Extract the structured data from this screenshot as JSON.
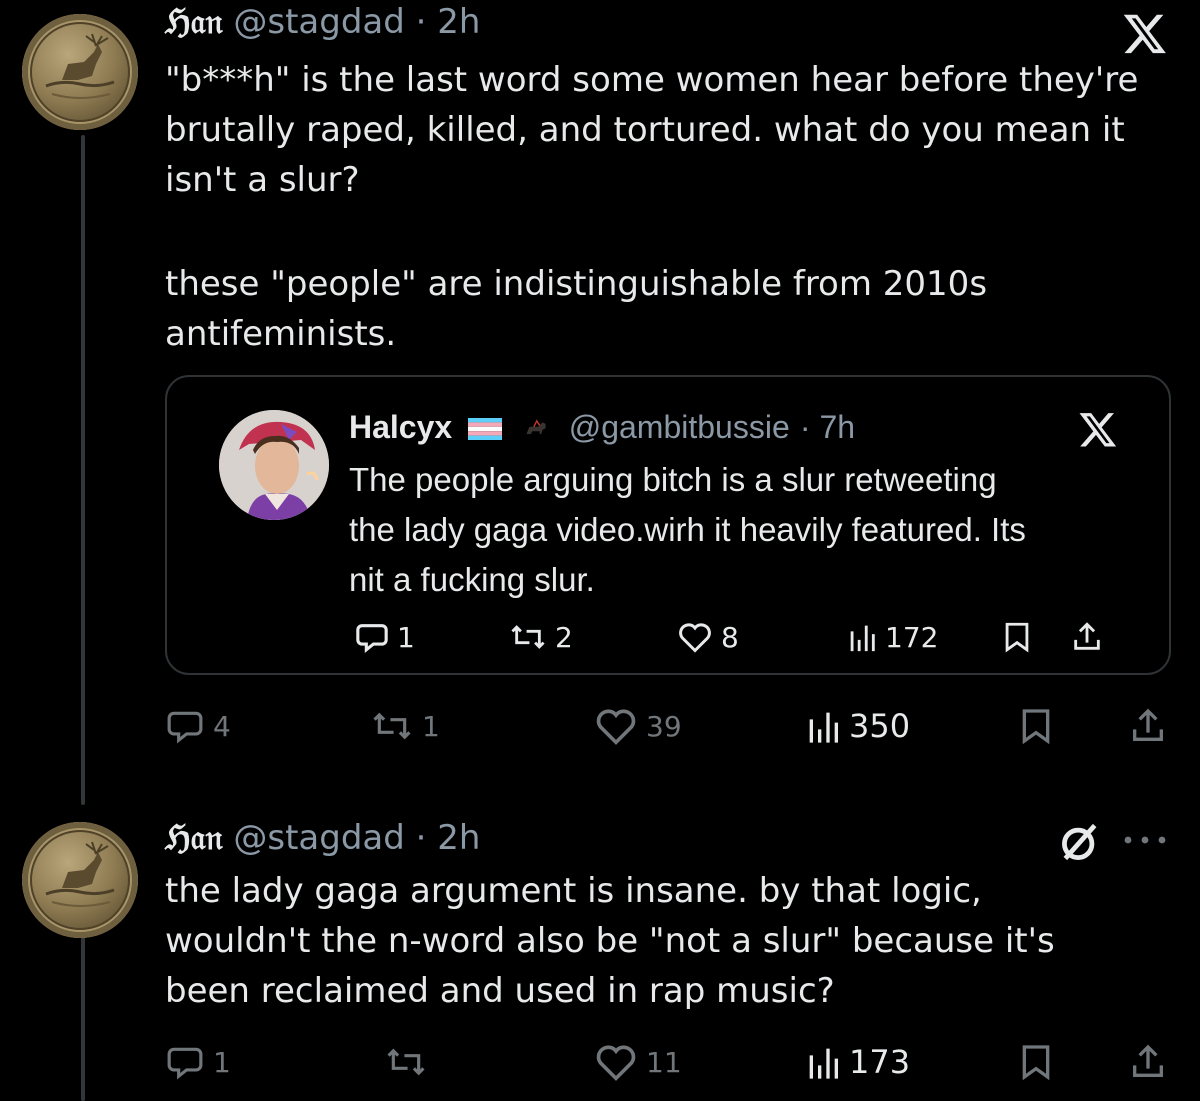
{
  "tweet1": {
    "name": "ℌ𝔞𝔫",
    "handle": "@stagdad",
    "time": "· 2h",
    "text_lines": [
      "\"b***h\" is the last word some women hear before they're",
      "brutally raped, killed, and tortured. what do you mean it",
      "isn't a slur?"
    ],
    "text_lines2": [
      "these \"people\" are indistinguishable from 2010s",
      "antifeminists."
    ],
    "replies": "4",
    "reposts": "1",
    "likes": "39",
    "views": "350"
  },
  "quote": {
    "name": "Halcyx",
    "handle": "@gambitbussie",
    "time": "· 7h",
    "text_lines": [
      "The people arguing bitch is a slur retweeting",
      "the lady gaga video.wirh it heavily featured. Its",
      "nit a fucking slur."
    ],
    "replies": "1",
    "reposts": "2",
    "likes": "8",
    "views": "172"
  },
  "tweet2": {
    "name": "ℌ𝔞𝔫",
    "handle": "@stagdad",
    "time": "· 2h",
    "text_lines": [
      "the lady gaga argument is insane. by that logic,",
      "wouldn't the n-word also be \"not a slur\" because it's",
      "been reclaimed and used in rap music?"
    ],
    "replies": "1",
    "likes": "11",
    "views": "173"
  },
  "icons": {
    "platform": "x-logo-icon",
    "reply": "speech-bubble-icon",
    "repost": "repost-arrows-icon",
    "like": "heart-icon",
    "views": "bar-chart-icon",
    "bookmark": "bookmark-icon",
    "share": "share-icon",
    "grok": "slashed-circle-icon",
    "more": "more-dots-icon"
  },
  "colors": {
    "background": "#000000",
    "text": "#e7e9ea",
    "muted": "#71767b",
    "border": "#2f3336"
  }
}
